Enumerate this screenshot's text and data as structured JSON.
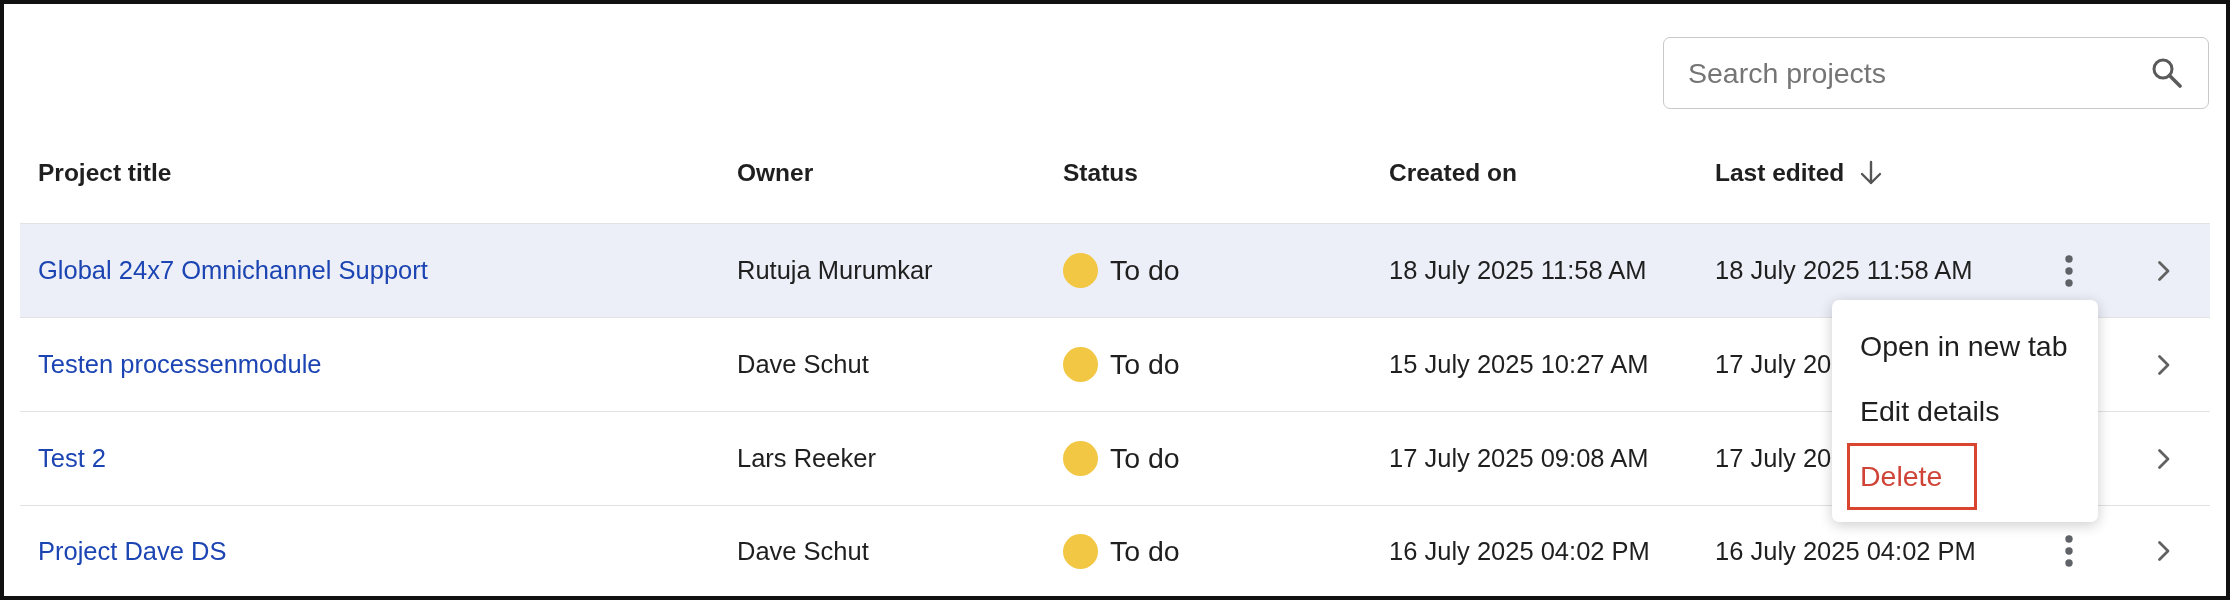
{
  "search": {
    "placeholder": "Search projects"
  },
  "table": {
    "columns": [
      {
        "label": "Project title",
        "sorted": false
      },
      {
        "label": "Owner",
        "sorted": false
      },
      {
        "label": "Status",
        "sorted": false
      },
      {
        "label": "Created on",
        "sorted": false
      },
      {
        "label": "Last edited",
        "sorted": true
      }
    ],
    "rows": [
      {
        "title": "Global 24x7 Omnichannel Support",
        "owner": "Rutuja Murumkar",
        "status": "To do",
        "created_on": "18 July 2025 11:58 AM",
        "last_edited": "18 July 2025 11:58 AM",
        "highlighted": true
      },
      {
        "title": "Testen processenmodule",
        "owner": "Dave Schut",
        "status": "To do",
        "created_on": "15 July 2025 10:27 AM",
        "last_edited": "17 July 20",
        "highlighted": false
      },
      {
        "title": "Test 2",
        "owner": "Lars Reeker",
        "status": "To do",
        "created_on": "17 July 2025 09:08 AM",
        "last_edited": "17 July 20",
        "highlighted": false
      },
      {
        "title": "Project Dave DS",
        "owner": "Dave Schut",
        "status": "To do",
        "created_on": "16 July 2025 04:02 PM",
        "last_edited": "16 July 2025 04:02 PM",
        "highlighted": false
      }
    ]
  },
  "context_menu": {
    "items": [
      {
        "label": "Open in new tab",
        "kind": "default",
        "outlined": false
      },
      {
        "label": "Edit details",
        "kind": "default",
        "outlined": false
      },
      {
        "label": "Delete",
        "kind": "destructive",
        "outlined": true
      }
    ]
  }
}
